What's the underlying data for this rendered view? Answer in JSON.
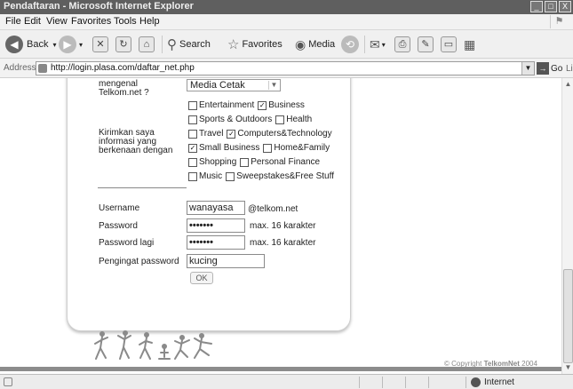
{
  "window": {
    "title": "Pendaftaran - Microsoft Internet Explorer",
    "buttons": [
      "_",
      "□",
      "X"
    ]
  },
  "menubar": {
    "items": [
      "File",
      "Edit",
      "View",
      "Favorites",
      "Tools",
      "Help"
    ]
  },
  "toolbar": {
    "back": "Back",
    "search": "Search",
    "favorites": "Favorites",
    "media": "Media"
  },
  "addressbar": {
    "label": "Address",
    "url": "http://login.plasa.com/daftar_net.php",
    "go": "Go",
    "links": "Links"
  },
  "form": {
    "mengenal_label_line1": "mengenal",
    "mengenal_label_line2": "Telkom.net ?",
    "source_select_value": "Media Cetak",
    "interests_label_line1": "Kirimkan saya",
    "interests_label_line2": "informasi yang",
    "interests_label_line3": "berkenaan dengan",
    "interests": [
      {
        "label": "Entertainment",
        "checked": false
      },
      {
        "label": "Business",
        "checked": true
      },
      {
        "label": "Sports & Outdoors",
        "checked": false
      },
      {
        "label": "Health",
        "checked": false
      },
      {
        "label": "Travel",
        "checked": false
      },
      {
        "label": "Computers&Technology",
        "checked": true
      },
      {
        "label": "Small Business",
        "checked": true
      },
      {
        "label": "Home&Family",
        "checked": false
      },
      {
        "label": "Shopping",
        "checked": false
      },
      {
        "label": "Personal Finance",
        "checked": false
      },
      {
        "label": "Music",
        "checked": false
      },
      {
        "label": "Sweepstakes&Free Stuff",
        "checked": false
      }
    ],
    "username_label": "Username",
    "username_value": "wanayasa",
    "username_suffix": "@telkom.net",
    "password_label": "Password",
    "password_value": "•••••••",
    "password_note": "max. 16 karakter",
    "password2_label": "Password lagi",
    "password2_value": "•••••••",
    "password2_note": "max. 16 karakter",
    "hint_label": "Pengingat password",
    "hint_value": "kucing",
    "ok_label": "OK"
  },
  "footer": {
    "copyright_prefix": "© Copyright ",
    "copyright_brand": "TelkomNet",
    "copyright_year": " 2004"
  },
  "statusbar": {
    "zone": "Internet"
  }
}
